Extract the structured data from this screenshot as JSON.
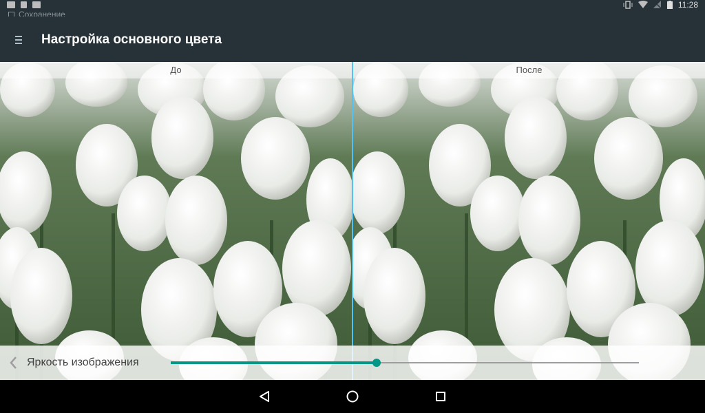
{
  "status_bar": {
    "time": "11:28",
    "left_icons": [
      "image-icon",
      "doc-icon",
      "copy-icon"
    ],
    "right_icons": [
      "vibrate-icon",
      "wifi-icon",
      "signal-icon",
      "battery-icon"
    ],
    "ghost_notification": "Сохранение"
  },
  "app_bar": {
    "title": "Настройка основного цвета",
    "menu_icon": "menu-icon"
  },
  "compare": {
    "before_label": "До",
    "after_label": "После"
  },
  "control": {
    "label": "Яркость изображения",
    "back_icon": "chevron-left-icon",
    "slider_value": 0.44
  },
  "nav_bar": {
    "icons": [
      "back-icon",
      "home-icon",
      "recents-icon"
    ]
  },
  "colors": {
    "app_bar": "#263238",
    "accent": "#009688",
    "divider": "#4fc3f7"
  }
}
